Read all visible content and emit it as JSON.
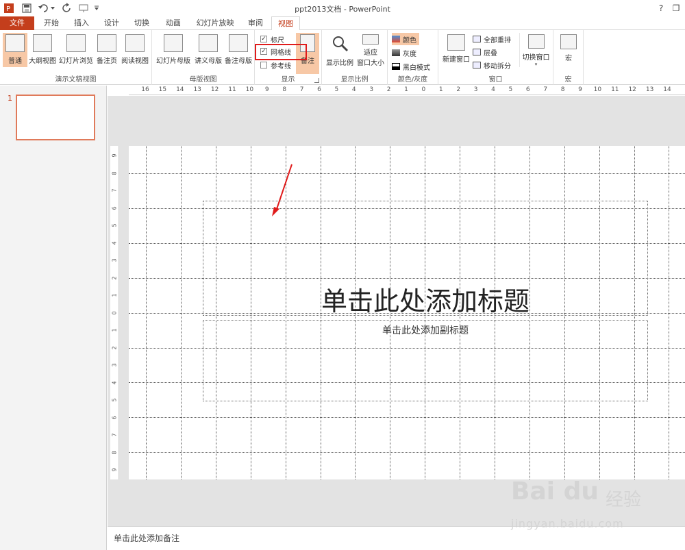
{
  "window": {
    "title": "ppt2013文档 - PowerPoint",
    "help_label": "?",
    "restore_label": "❐",
    "minimize_label": "—"
  },
  "tabs": [
    {
      "label": "文件"
    },
    {
      "label": "开始"
    },
    {
      "label": "插入"
    },
    {
      "label": "设计"
    },
    {
      "label": "切换"
    },
    {
      "label": "动画"
    },
    {
      "label": "幻灯片放映"
    },
    {
      "label": "审阅"
    },
    {
      "label": "视图"
    }
  ],
  "ribbon": {
    "presentation_views": {
      "label": "演示文稿视图",
      "buttons": [
        "普通",
        "大纲视图",
        "幻灯片浏览",
        "备注页",
        "阅读视图"
      ]
    },
    "master_views": {
      "label": "母版视图",
      "buttons": [
        "幻灯片母版",
        "讲义母版",
        "备注母版"
      ]
    },
    "show": {
      "label": "显示",
      "ruler": "标尺",
      "gridlines": "网格线",
      "guides": "参考线",
      "notes": "备注",
      "ruler_checked": true,
      "gridlines_checked": true,
      "guides_checked": false
    },
    "zoom": {
      "label": "显示比例",
      "zoom_btn": "显示比例",
      "fit_line1": "适应",
      "fit_line2": "窗口大小"
    },
    "color": {
      "label": "颜色/灰度",
      "color": "颜色",
      "gray": "灰度",
      "bw": "黑白模式"
    },
    "window": {
      "label": "窗口",
      "new_window": "新建窗口",
      "arrange_all": "全部重排",
      "cascade": "层叠",
      "move_split": "移动拆分",
      "switch_windows": "切换窗口"
    },
    "macro": {
      "label": "宏",
      "macros": "宏"
    }
  },
  "rulers": {
    "horizontal": [
      "16",
      "15",
      "14",
      "13",
      "12",
      "11",
      "10",
      "9",
      "8",
      "7",
      "6",
      "5",
      "4",
      "3",
      "2",
      "1",
      "0",
      "1",
      "2",
      "3",
      "4",
      "5",
      "6",
      "7",
      "8",
      "9",
      "10",
      "11",
      "12",
      "13",
      "14"
    ],
    "vertical": [
      "9",
      "8",
      "7",
      "6",
      "5",
      "4",
      "3",
      "2",
      "1",
      "0",
      "1",
      "2",
      "3",
      "4",
      "5",
      "6",
      "7",
      "8",
      "9"
    ]
  },
  "thumbnail": {
    "number": "1"
  },
  "slide": {
    "title_placeholder": "单击此处添加标题",
    "subtitle_placeholder": "单击此处添加副标题"
  },
  "notes": {
    "placeholder": "单击此处添加备注"
  },
  "watermark": {
    "logo": "Bai du",
    "cn": "经验",
    "url": "jingyan.baidu.com"
  },
  "colors": {
    "accent": "#c43e1c",
    "selected_bg": "#f7c8a6",
    "highlight": "#e01b1b"
  }
}
